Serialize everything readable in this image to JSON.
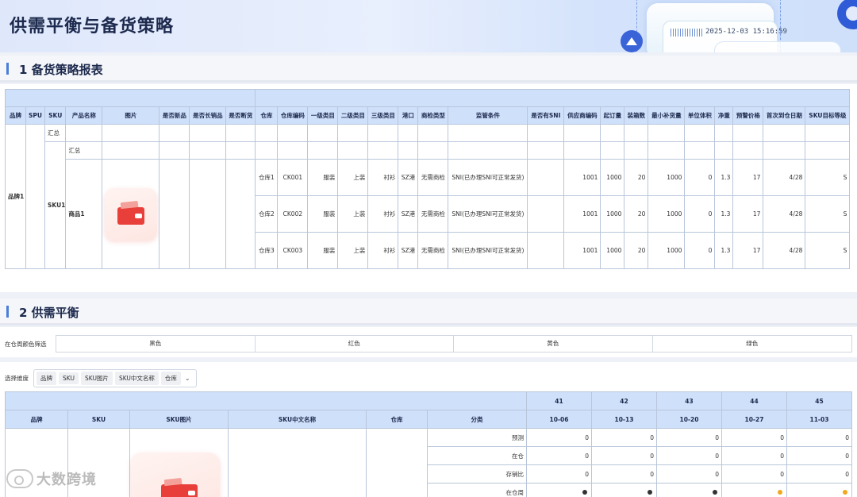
{
  "header": {
    "title": "供需平衡与备货策略",
    "datetime": "2025-12-03 15:16:59"
  },
  "section1": {
    "title": "1 备货策略报表",
    "columns": [
      "品牌",
      "SPU",
      "SKU",
      "产品名称",
      "图片",
      "是否新品",
      "是否长销品",
      "是否断货",
      "仓库",
      "仓库编码",
      "一级类目",
      "二级类目",
      "三级类目",
      "港口",
      "商检类型",
      "监管条件",
      "是否有SNI",
      "供应商编码",
      "起订量",
      "装箱数",
      "最小补货量",
      "单位体积",
      "净重",
      "预警价格",
      "首次到仓日期",
      "SKU目标等级"
    ],
    "brand": "品牌1",
    "sku": "SKU1",
    "summary": "汇总",
    "product": "商品1",
    "rows": [
      {
        "warehouse": "仓库1",
        "code": "CK001",
        "cat1": "服装",
        "cat2": "上装",
        "cat3": "衬衫",
        "port": "SZ港",
        "inspect": "无需商检",
        "reg": "SNI(已办理SNI可正常发货)",
        "supplier": "1001",
        "moq": "1000",
        "box": "20",
        "min_rep": "1000",
        "volume": "0",
        "weight": "1.3",
        "price": "17",
        "first_date": "4/28",
        "level": "S"
      },
      {
        "warehouse": "仓库2",
        "code": "CK002",
        "cat1": "服装",
        "cat2": "上装",
        "cat3": "衬衫",
        "port": "SZ港",
        "inspect": "无需商检",
        "reg": "SNI(已办理SNI可正常发货)",
        "supplier": "1001",
        "moq": "1000",
        "box": "20",
        "min_rep": "1000",
        "volume": "0",
        "weight": "1.3",
        "price": "17",
        "first_date": "4/28",
        "level": "S"
      },
      {
        "warehouse": "仓库3",
        "code": "CK003",
        "cat1": "服装",
        "cat2": "上装",
        "cat3": "衬衫",
        "port": "SZ港",
        "inspect": "无需商检",
        "reg": "SNI(已办理SNI可正常发货)",
        "supplier": "1001",
        "moq": "1000",
        "box": "20",
        "min_rep": "1000",
        "volume": "0",
        "weight": "1.3",
        "price": "17",
        "first_date": "4/28",
        "level": "S"
      }
    ]
  },
  "section2": {
    "title": "2 供需平衡",
    "filter_label": "在仓周颜色筛选",
    "colors": [
      "黑色",
      "红色",
      "黄色",
      "绿色"
    ],
    "dim_label": "选择维度",
    "dim_tags": [
      "品牌",
      "SKU",
      "SKU图片",
      "SKU中文名称",
      "仓库"
    ],
    "columns": [
      "品牌",
      "SKU",
      "SKU图片",
      "SKU中文名称",
      "仓库",
      "分类"
    ],
    "weeks": [
      {
        "week": "41",
        "date": "10-06"
      },
      {
        "week": "42",
        "date": "10-13"
      },
      {
        "week": "43",
        "date": "10-20"
      },
      {
        "week": "44",
        "date": "10-27"
      },
      {
        "week": "45",
        "date": "11-03"
      }
    ],
    "rows": [
      {
        "label": "预测",
        "values": [
          "0",
          "0",
          "0",
          "0",
          "0"
        ]
      },
      {
        "label": "在仓",
        "values": [
          "0",
          "0",
          "0",
          "0",
          "0"
        ]
      },
      {
        "label": "存销比",
        "values": [
          "0",
          "0",
          "0",
          "0",
          "0"
        ]
      },
      {
        "label": "在仓周",
        "dots": [
          "#333333",
          "#333333",
          "#333333",
          "#f0a81c",
          "#f0a81c"
        ]
      }
    ]
  },
  "watermark": "大数跨境"
}
